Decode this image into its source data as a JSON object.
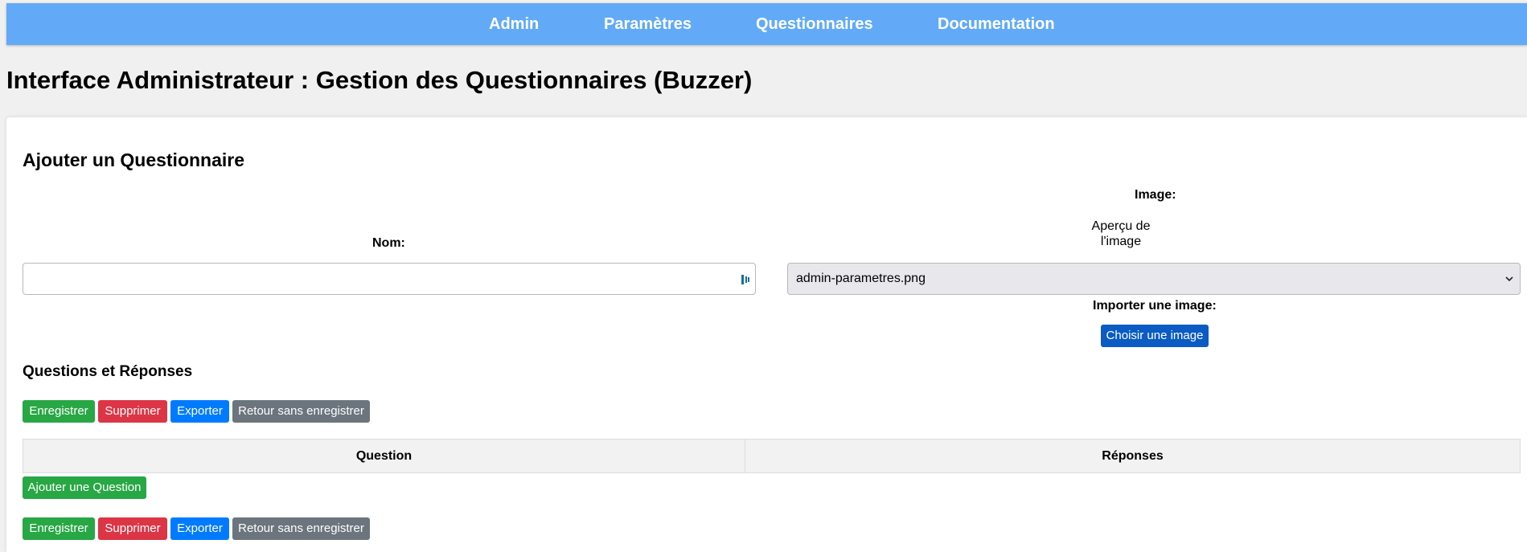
{
  "nav": {
    "items": [
      "Admin",
      "Paramètres",
      "Questionnaires",
      "Documentation"
    ]
  },
  "page": {
    "title": "Interface Administrateur : Gestion des Questionnaires (Buzzer)"
  },
  "form": {
    "section_title": "Ajouter un Questionnaire",
    "nom_label": "Nom:",
    "nom_value": "",
    "image_label": "Image:",
    "preview_text": "Aperçu de l'image",
    "image_select_value": "admin-parametres.png",
    "import_label": "Importer une image:",
    "choose_image_button": "Choisir une image"
  },
  "qa": {
    "title": "Questions et Réponses",
    "actions": {
      "save": "Enregistrer",
      "delete": "Supprimer",
      "export": "Exporter",
      "back": "Retour sans enregistrer"
    },
    "table_headers": [
      "Question",
      "Réponses"
    ],
    "add_question_button": "Ajouter une Question"
  },
  "colors": {
    "navbar": "#62aaf8",
    "save": "#28a745",
    "delete": "#dc3545",
    "export": "#007bff",
    "back": "#6c757d",
    "choose_image": "#0a5bc4"
  },
  "icons": {
    "password_manager": "password-manager-icon",
    "select_chevron": "chevron-down-icon"
  }
}
